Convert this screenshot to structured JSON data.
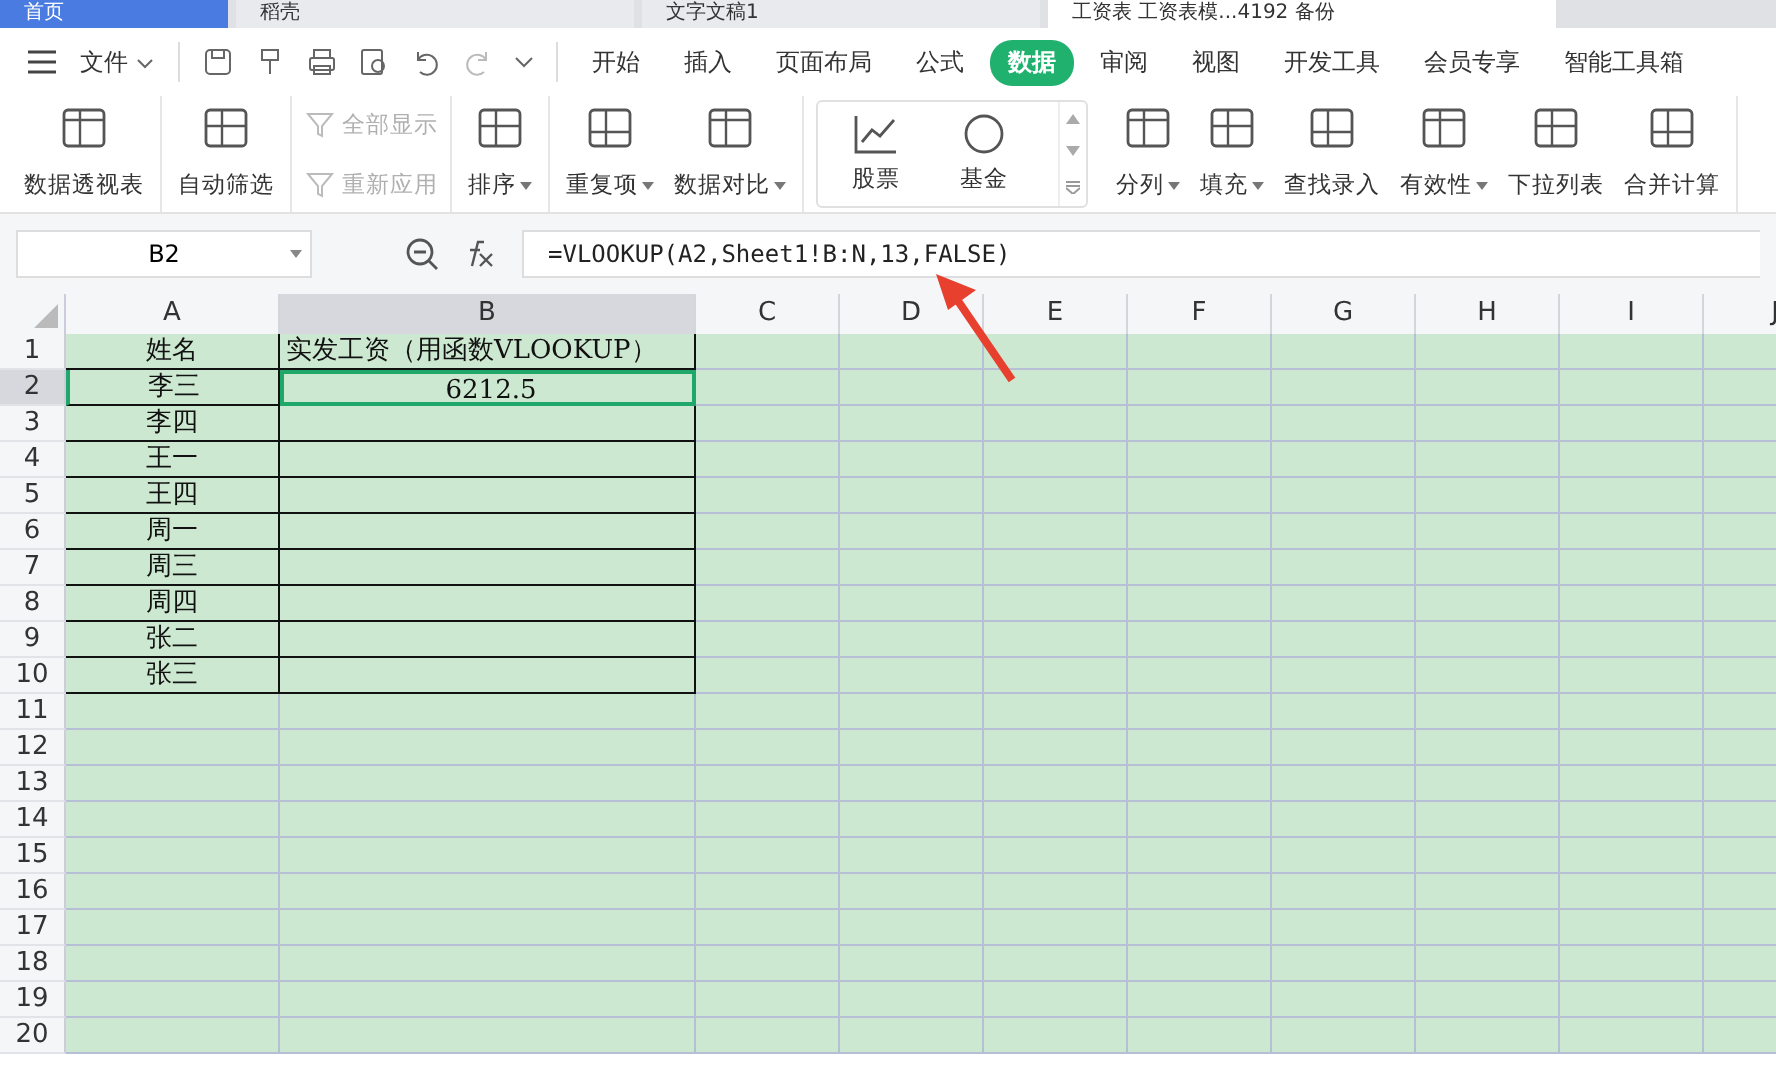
{
  "doc_tabs": [
    {
      "label": "首页",
      "selected": false
    },
    {
      "label": "稻壳",
      "selected": false
    },
    {
      "label": "文字文稿1",
      "selected": false
    },
    {
      "label": "工资表 工资表模...4192 备份",
      "selected": true
    }
  ],
  "menu": {
    "file": "文件",
    "tabs": [
      {
        "label": "开始",
        "selected": false
      },
      {
        "label": "插入",
        "selected": false
      },
      {
        "label": "页面布局",
        "selected": false
      },
      {
        "label": "公式",
        "selected": false
      },
      {
        "label": "数据",
        "selected": true
      },
      {
        "label": "审阅",
        "selected": false
      },
      {
        "label": "视图",
        "selected": false
      },
      {
        "label": "开发工具",
        "selected": false
      },
      {
        "label": "会员专享",
        "selected": false
      },
      {
        "label": "智能工具箱",
        "selected": false
      }
    ]
  },
  "ribbon": [
    {
      "kind": "large",
      "items": [
        {
          "label": "数据透视表",
          "dropdown": false,
          "disabled": false
        }
      ]
    },
    {
      "kind": "large",
      "items": [
        {
          "label": "自动筛选",
          "dropdown": false,
          "disabled": false
        }
      ]
    },
    {
      "kind": "stack",
      "items": [
        {
          "label": "全部显示",
          "dropdown": false,
          "disabled": true
        },
        {
          "label": "重新应用",
          "dropdown": false,
          "disabled": true
        }
      ]
    },
    {
      "kind": "large",
      "items": [
        {
          "label": "排序",
          "dropdown": true,
          "disabled": false
        }
      ]
    },
    {
      "kind": "large",
      "items": [
        {
          "label": "重复项",
          "dropdown": true,
          "disabled": false
        },
        {
          "label": "数据对比",
          "dropdown": true,
          "disabled": false
        }
      ]
    },
    {
      "kind": "gallery",
      "items": [
        {
          "label": "股票",
          "dropdown": false,
          "disabled": false
        },
        {
          "label": "基金",
          "dropdown": false,
          "disabled": false
        }
      ]
    },
    {
      "kind": "large",
      "items": [
        {
          "label": "分列",
          "dropdown": true,
          "disabled": false
        },
        {
          "label": "填充",
          "dropdown": true,
          "disabled": false
        },
        {
          "label": "查找录入",
          "dropdown": false,
          "disabled": false
        },
        {
          "label": "有效性",
          "dropdown": true,
          "disabled": false
        },
        {
          "label": "下拉列表",
          "dropdown": false,
          "disabled": false
        },
        {
          "label": "合并计算",
          "dropdown": false,
          "disabled": false
        }
      ]
    }
  ],
  "formula_bar": {
    "name_box": "B2",
    "formula": "=VLOOKUP(A2,Sheet1!B:N,13,FALSE)"
  },
  "columns": [
    {
      "label": "A",
      "selected": false
    },
    {
      "label": "B",
      "selected": true
    },
    {
      "label": "C",
      "selected": false
    },
    {
      "label": "D",
      "selected": false
    },
    {
      "label": "E",
      "selected": false
    },
    {
      "label": "F",
      "selected": false
    },
    {
      "label": "G",
      "selected": false
    },
    {
      "label": "H",
      "selected": false
    },
    {
      "label": "I",
      "selected": false
    },
    {
      "label": "J",
      "selected": false
    }
  ],
  "rows": [
    {
      "label": "1",
      "selected": false,
      "bordered": true,
      "cells": [
        "姓名",
        "实发工资（用函数VLOOKUP）"
      ]
    },
    {
      "label": "2",
      "selected": true,
      "bordered": true,
      "cells": [
        "李三",
        "6212.5"
      ]
    },
    {
      "label": "3",
      "selected": false,
      "bordered": true,
      "cells": [
        "李四",
        ""
      ]
    },
    {
      "label": "4",
      "selected": false,
      "bordered": true,
      "cells": [
        "王一",
        ""
      ]
    },
    {
      "label": "5",
      "selected": false,
      "bordered": true,
      "cells": [
        "王四",
        ""
      ]
    },
    {
      "label": "6",
      "selected": false,
      "bordered": true,
      "cells": [
        "周一",
        ""
      ]
    },
    {
      "label": "7",
      "selected": false,
      "bordered": true,
      "cells": [
        "周三",
        ""
      ]
    },
    {
      "label": "8",
      "selected": false,
      "bordered": true,
      "cells": [
        "周四",
        ""
      ]
    },
    {
      "label": "9",
      "selected": false,
      "bordered": true,
      "cells": [
        "张二",
        ""
      ]
    },
    {
      "label": "10",
      "selected": false,
      "bordered": true,
      "cells": [
        "张三",
        ""
      ]
    },
    {
      "label": "11",
      "selected": false,
      "bordered": false,
      "cells": []
    },
    {
      "label": "12",
      "selected": false,
      "bordered": false,
      "cells": []
    },
    {
      "label": "13",
      "selected": false,
      "bordered": false,
      "cells": []
    },
    {
      "label": "14",
      "selected": false,
      "bordered": false,
      "cells": []
    },
    {
      "label": "15",
      "selected": false,
      "bordered": false,
      "cells": []
    },
    {
      "label": "16",
      "selected": false,
      "bordered": false,
      "cells": []
    },
    {
      "label": "17",
      "selected": false,
      "bordered": false,
      "cells": []
    },
    {
      "label": "18",
      "selected": false,
      "bordered": false,
      "cells": []
    },
    {
      "label": "19",
      "selected": false,
      "bordered": false,
      "cells": []
    },
    {
      "label": "20",
      "selected": false,
      "bordered": false,
      "cells": []
    }
  ]
}
